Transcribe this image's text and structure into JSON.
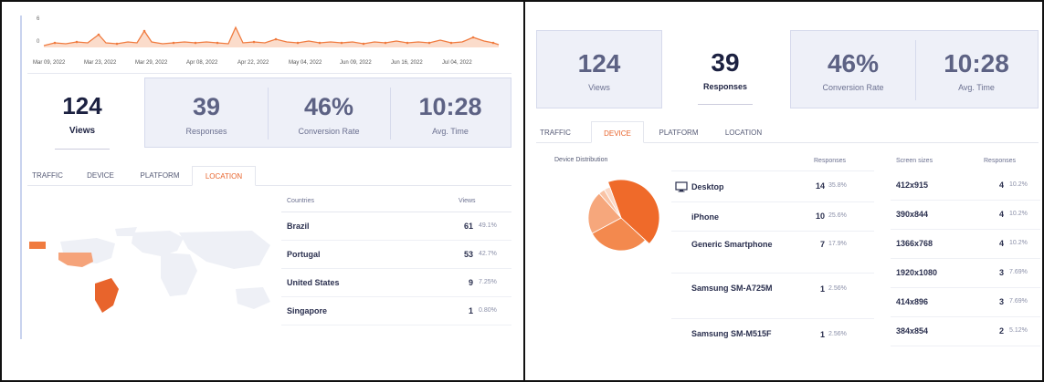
{
  "left": {
    "minichart": {
      "y_labels": [
        "6",
        "0"
      ],
      "dates": [
        "Mar 09, 2022",
        "Mar 23, 2022",
        "Mar 29, 2022",
        "Apr 08, 2022",
        "Apr 22, 2022",
        "May 04, 2022",
        "Jun 09, 2022",
        "Jun 16, 2022",
        "Jul 04, 2022"
      ],
      "accent": "#f07b3f"
    },
    "stats": {
      "views": {
        "value": "124",
        "label": "Views"
      },
      "responses": {
        "value": "39",
        "label": "Responses"
      },
      "conversion": {
        "value": "46%",
        "label": "Conversion Rate"
      },
      "avg_time": {
        "value": "10:28",
        "label": "Avg. Time"
      }
    },
    "tabs": [
      "TRAFFIC",
      "DEVICE",
      "PLATFORM",
      "LOCATION"
    ],
    "active_tab": "LOCATION",
    "countries": {
      "col_country": "Countries",
      "col_views": "Views",
      "rows": [
        {
          "name": "Brazil",
          "count": "61",
          "pct": "49.1%"
        },
        {
          "name": "Portugal",
          "count": "53",
          "pct": "42.7%"
        },
        {
          "name": "United States",
          "count": "9",
          "pct": "7.25%"
        },
        {
          "name": "Singapore",
          "count": "1",
          "pct": "0.80%"
        }
      ]
    }
  },
  "right": {
    "stats": {
      "views": {
        "value": "124",
        "label": "Views"
      },
      "responses": {
        "value": "39",
        "label": "Responses"
      },
      "conversion": {
        "value": "46%",
        "label": "Conversion Rate"
      },
      "avg_time": {
        "value": "10:28",
        "label": "Avg. Time"
      }
    },
    "tabs": [
      "TRAFFIC",
      "DEVICE",
      "PLATFORM",
      "LOCATION"
    ],
    "active_tab": "DEVICE",
    "device_distribution_label": "Device Distribution",
    "devices": {
      "col_responses": "Responses",
      "rows": [
        {
          "name": "Desktop",
          "count": "14",
          "pct": "35.8%",
          "icon": "monitor-icon"
        },
        {
          "name": "iPhone",
          "count": "10",
          "pct": "25.6%"
        },
        {
          "name": "Generic Smartphone",
          "count": "7",
          "pct": "17.9%"
        },
        {
          "name": "Samsung SM-A725M",
          "count": "1",
          "pct": "2.56%"
        },
        {
          "name": "Samsung SM-M515F",
          "count": "1",
          "pct": "2.56%"
        }
      ]
    },
    "screens": {
      "col_sizes": "Screen sizes",
      "col_responses": "Responses",
      "rows": [
        {
          "size": "412x915",
          "count": "4",
          "pct": "10.2%"
        },
        {
          "size": "390x844",
          "count": "4",
          "pct": "10.2%"
        },
        {
          "size": "1366x768",
          "count": "4",
          "pct": "10.2%"
        },
        {
          "size": "1920x1080",
          "count": "3",
          "pct": "7.69%"
        },
        {
          "size": "414x896",
          "count": "3",
          "pct": "7.69%"
        },
        {
          "size": "384x854",
          "count": "2",
          "pct": "5.12%"
        }
      ]
    },
    "pie_colors": [
      "#ef6a2a",
      "#f3894e",
      "#f6a77c",
      "#f9c3a5",
      "#fbd9c7"
    ]
  },
  "chart_data": {
    "type": "pie",
    "title": "Device Distribution",
    "categories": [
      "Desktop",
      "iPhone",
      "Generic Smartphone",
      "Samsung SM-A725M",
      "Samsung SM-M515F"
    ],
    "values": [
      14,
      10,
      7,
      1,
      1
    ]
  }
}
